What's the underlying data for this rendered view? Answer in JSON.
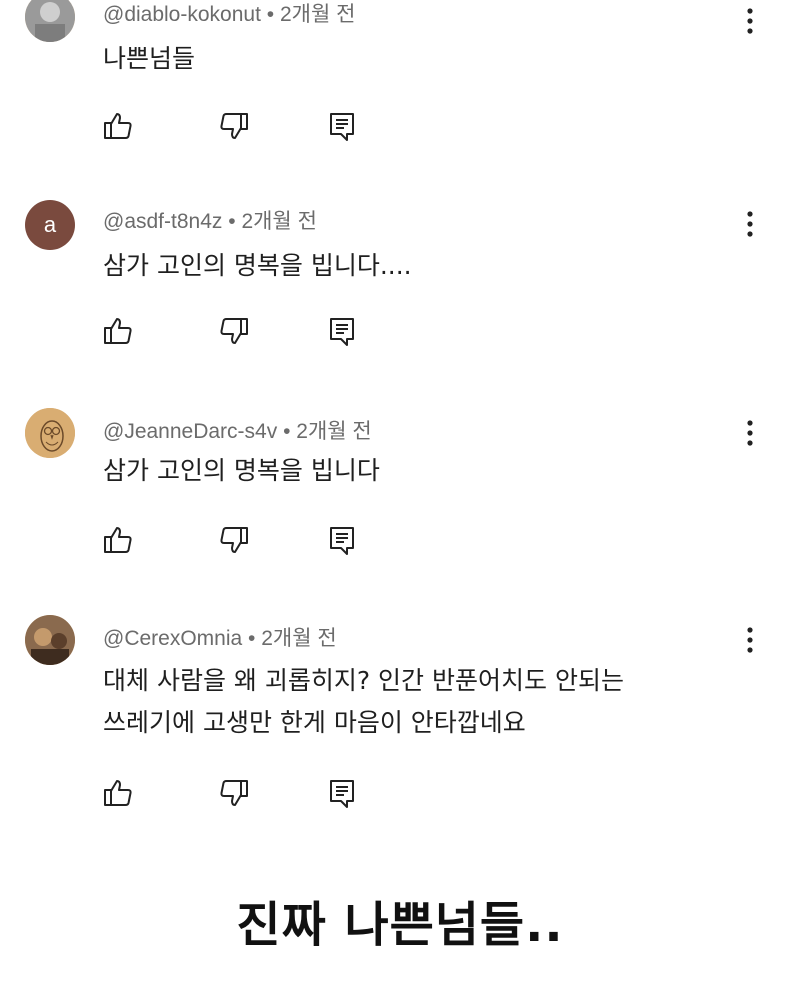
{
  "comments": [
    {
      "handle": "@diablo-kokonut",
      "time": "2개월 전",
      "text": "나쁜넘들",
      "avatar": {
        "type": "image",
        "icon": "avatar-photo"
      }
    },
    {
      "handle": "@asdf-t8n4z",
      "time": "2개월 전",
      "text": "삼가 고인의 명복을 빕니다....",
      "avatar": {
        "type": "letter",
        "letter": "a",
        "color": "#7a4a3e"
      }
    },
    {
      "handle": "@JeanneDarc-s4v",
      "time": "2개월 전",
      "text": "삼가 고인의 명복을 빕니다",
      "avatar": {
        "type": "image",
        "icon": "owl-drawing"
      }
    },
    {
      "handle": "@CerexOmnia",
      "time": "2개월 전",
      "text": "대체 사람을 왜 괴롭히지? 인간 반푼어치도 안되는\n쓰레기에 고생만 한게 마음이 안타깝네요",
      "avatar": {
        "type": "image",
        "icon": "avatar-photo"
      }
    }
  ],
  "separator": "•",
  "icons": {
    "like": "thumbs-up-icon",
    "dislike": "thumbs-down-icon",
    "reply": "reply-comment-icon",
    "more": "more-vertical-icon"
  },
  "caption": "진짜 나쁜넘들.."
}
